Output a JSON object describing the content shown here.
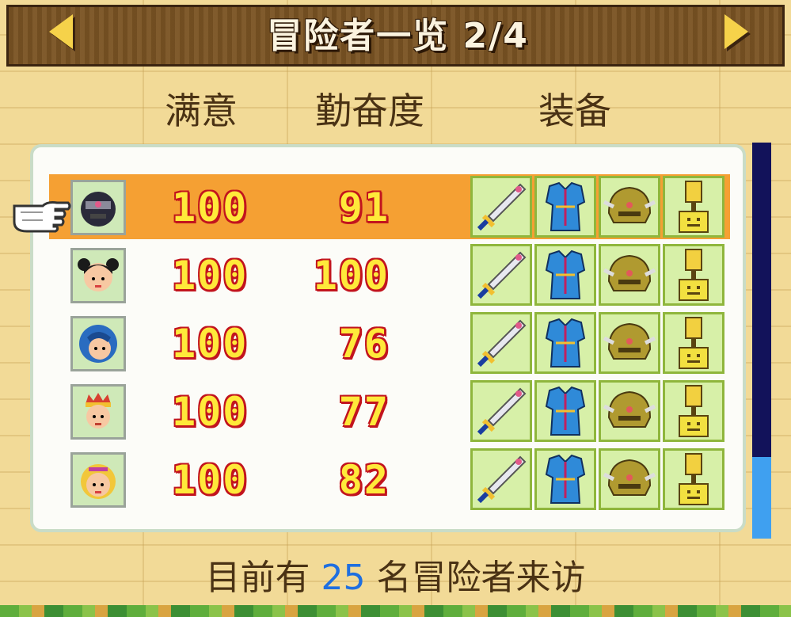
{
  "header": {
    "title": "冒险者一览 2/4",
    "prev_icon": "arrow-left-icon",
    "next_icon": "arrow-right-icon"
  },
  "columns": {
    "satisfaction": "满意",
    "diligence": "勤奋度",
    "equipment": "装备"
  },
  "adventurers": [
    {
      "avatar": "ninja-avatar",
      "satisfaction": "100",
      "diligence": "91",
      "selected": true
    },
    {
      "avatar": "pigtail-girl-avatar",
      "satisfaction": "100",
      "diligence": "100",
      "selected": false
    },
    {
      "avatar": "blue-hood-avatar",
      "satisfaction": "100",
      "diligence": "76",
      "selected": false
    },
    {
      "avatar": "crowned-avatar",
      "satisfaction": "100",
      "diligence": "77",
      "selected": false
    },
    {
      "avatar": "blonde-avatar",
      "satisfaction": "100",
      "diligence": "82",
      "selected": false
    }
  ],
  "equipment_icons": [
    "sword-icon",
    "armor-icon",
    "helmet-icon",
    "trophy-icon"
  ],
  "footer": {
    "prefix": "目前有 ",
    "count": "25",
    "suffix": " 名冒险者来访"
  },
  "colors": {
    "selected_row": "#f5a033",
    "number_fill": "#ffe93a",
    "number_outline": "#c2141e",
    "count_color": "#1f6fe0"
  }
}
